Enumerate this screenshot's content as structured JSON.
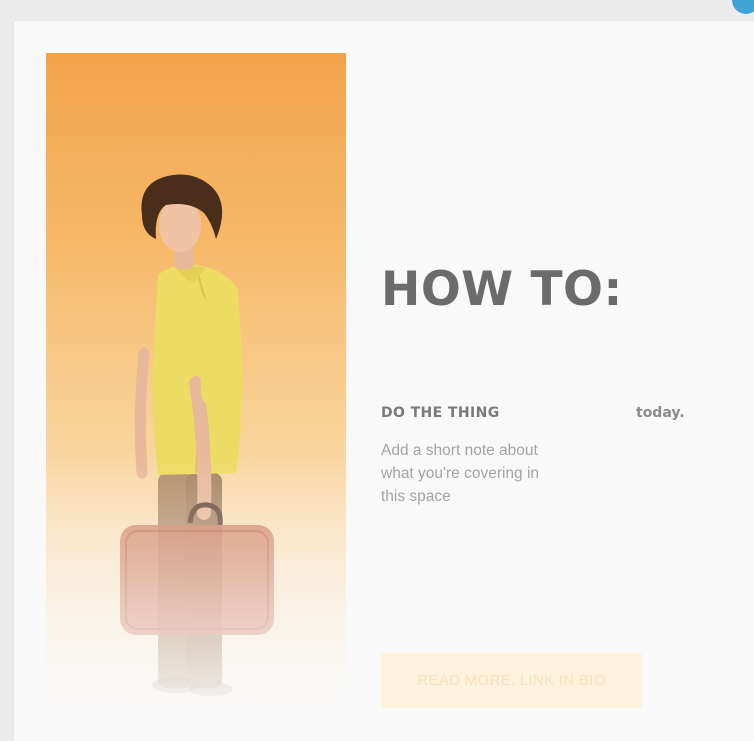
{
  "headline": "HOW TO:",
  "subheading": {
    "left": "DO THE THING",
    "right": "today."
  },
  "note": "Add a short note about what you're covering in this space",
  "cta": {
    "label": "READ MORE, LINK IN BIO"
  },
  "colors": {
    "photo_background_top": "#f3a24b",
    "headline_text": "#6b6b6b",
    "cta_background": "#fdf2dc",
    "corner_accent": "#3fa3d6"
  }
}
